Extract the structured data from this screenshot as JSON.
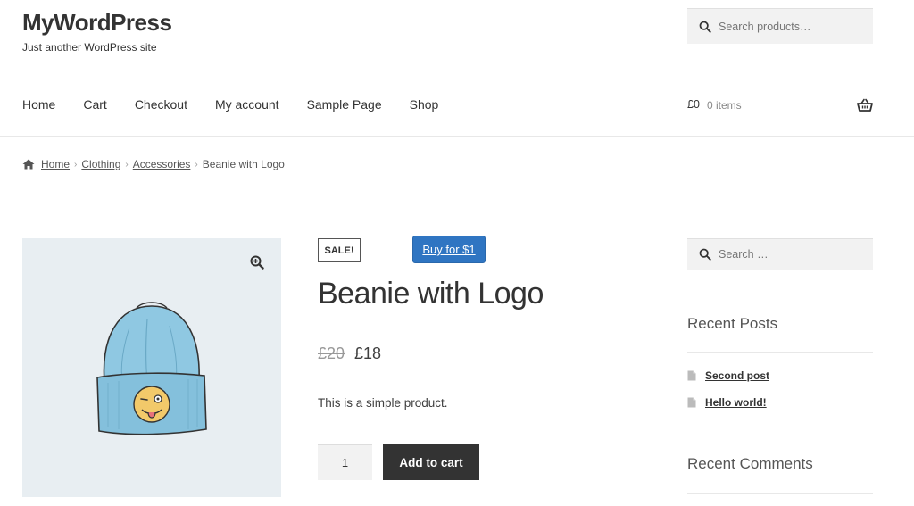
{
  "site": {
    "title": "MyWordPress",
    "tagline": "Just another WordPress site"
  },
  "header_search": {
    "placeholder": "Search products…",
    "icon": "search-icon"
  },
  "nav": {
    "items": [
      "Home",
      "Cart",
      "Checkout",
      "My account",
      "Sample Page",
      "Shop"
    ]
  },
  "cart": {
    "total": "£0",
    "items": "0 items",
    "icon": "basket-icon"
  },
  "breadcrumb": {
    "icon": "home-icon",
    "links": [
      "Home",
      "Clothing",
      "Accessories"
    ],
    "current": "Beanie with Logo"
  },
  "product": {
    "sale_badge": "SALE!",
    "buy_button": "Buy for $1",
    "title": "Beanie with Logo",
    "price_old": "£20",
    "price_new": "£18",
    "description": "This is a simple product.",
    "quantity": "1",
    "add_to_cart": "Add to cart",
    "zoom_icon": "zoom-in-icon"
  },
  "sidebar": {
    "search_placeholder": "Search …",
    "recent_posts_title": "Recent Posts",
    "posts": [
      "Second post",
      "Hello world!"
    ],
    "recent_comments_title": "Recent Comments"
  },
  "colors": {
    "primary_button": "#333333",
    "buy_button": "#2f75c2",
    "image_background": "#e8eef2",
    "input_background": "#f2f2f2"
  }
}
